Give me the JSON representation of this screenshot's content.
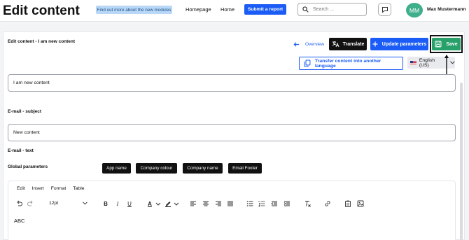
{
  "header": {
    "title": "Edit content",
    "banner_label": "Find out more about the new modules",
    "nav": [
      "Homepage",
      "Home"
    ],
    "submit_label": "Submit a report",
    "search_placeholder": "Search ...",
    "user_initials": "MM",
    "user_name": "Max Mustermann"
  },
  "content": {
    "heading": "Edit content - I am new content",
    "actions": {
      "overview_label": "Overview",
      "translate_label": "Translate",
      "update_label": "Update parameters",
      "save_label": "Save",
      "transfer_label": "Transfer content into another language",
      "language_value": "English (US)"
    },
    "title_value": "I am new content",
    "email_subject_label": "E-mail - subject",
    "email_subject_value": "New content",
    "email_text_label": "E-mail - text",
    "global_params_label": "Global parameters",
    "global_params": [
      "App name",
      "Company colour",
      "Company name",
      "Email Footer"
    ]
  },
  "editor": {
    "menu": [
      "Edit",
      "Insert",
      "Format",
      "Table"
    ],
    "font_size": "12pt",
    "body_text": "ABC"
  },
  "colors": {
    "primary": "#1a5cf5",
    "save_green": "#27a06a",
    "avatar": "#3fae8a",
    "banner": "#b9d8f7"
  }
}
